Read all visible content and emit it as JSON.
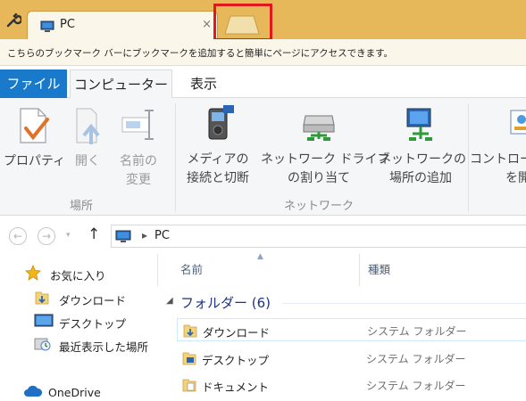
{
  "browser": {
    "tab_title": "PC",
    "tab_close": "×",
    "bookmark_bar_text": "こちらのブックマーク バーにブックマークを追加すると簡単にページにアクセスできます。"
  },
  "ribbon": {
    "tabs": {
      "file": "ファイル",
      "computer": "コンピューター",
      "view": "表示"
    },
    "buttons": {
      "properties": "プロパティ",
      "open": "開く",
      "rename_1": "名前の",
      "rename_2": "変更",
      "media_1": "メディアの",
      "media_2": "接続と切断",
      "map_drive_1": "ネットワーク ドライブ",
      "map_drive_2": "の割り当て",
      "add_location_1": "ネットワークの",
      "add_location_2": "場所の追加",
      "control_panel_1": "コントロー",
      "control_panel_2": "を開"
    },
    "groups": {
      "location": "場所",
      "network": "ネットワーク"
    }
  },
  "address": {
    "back": "←",
    "forward": "→",
    "dropdown": "▾",
    "up": "↑",
    "separator": "▸",
    "path": "PC"
  },
  "navpane": {
    "favorites": "お気に入り",
    "downloads": "ダウンロード",
    "desktop": "デスクトップ",
    "recent": "最近表示した場所",
    "onedrive": "OneDrive"
  },
  "content": {
    "col_name": "名前",
    "col_type": "種類",
    "group_header": "フォルダー (6)",
    "rows": [
      {
        "name": "ダウンロード",
        "type": "システム フォルダー"
      },
      {
        "name": "デスクトップ",
        "type": "システム フォルダー"
      },
      {
        "name": "ドキュメント",
        "type": "システム フォルダー"
      }
    ]
  },
  "colors": {
    "accent": "#1979ca",
    "highlight_box": "#e0191b",
    "chrome": "#e7b85a"
  }
}
